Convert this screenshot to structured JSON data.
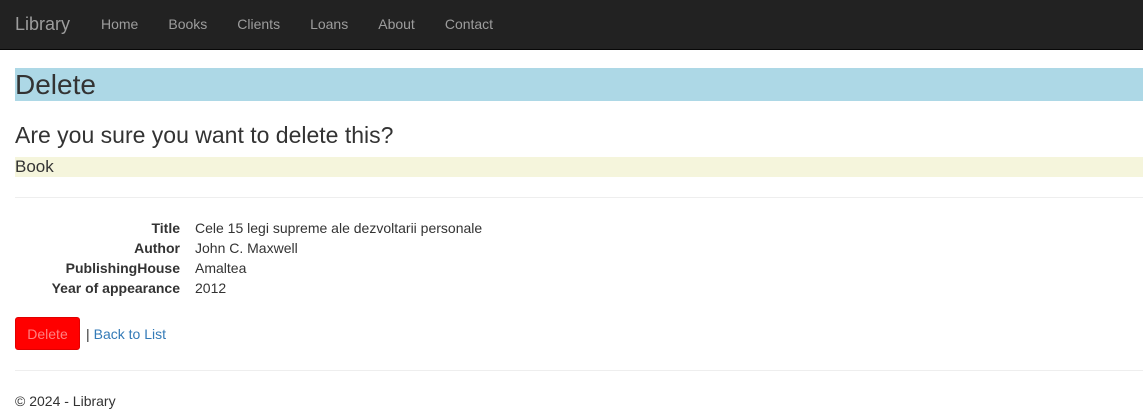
{
  "navbar": {
    "brand": "Library",
    "items": [
      {
        "label": "Home"
      },
      {
        "label": "Books"
      },
      {
        "label": "Clients"
      },
      {
        "label": "Loans"
      },
      {
        "label": "About"
      },
      {
        "label": "Contact"
      }
    ]
  },
  "page": {
    "heading": "Delete",
    "question": "Are you sure you want to delete this?",
    "entity": "Book"
  },
  "details": [
    {
      "label": "Title",
      "value": "Cele 15 legi supreme ale dezvoltarii personale"
    },
    {
      "label": "Author",
      "value": "John C. Maxwell"
    },
    {
      "label": "PublishingHouse",
      "value": "Amaltea"
    },
    {
      "label": "Year of appearance",
      "value": "2012"
    }
  ],
  "actions": {
    "delete_label": "Delete",
    "separator": "|",
    "back_label": "Back to List"
  },
  "footer": {
    "text": "© 2024 - Library"
  },
  "colors": {
    "navbar_bg": "#222222",
    "heading_bg": "#add8e6",
    "entity_bg": "#f5f5dc",
    "delete_button": "#ff0000",
    "link": "#337ab7"
  }
}
